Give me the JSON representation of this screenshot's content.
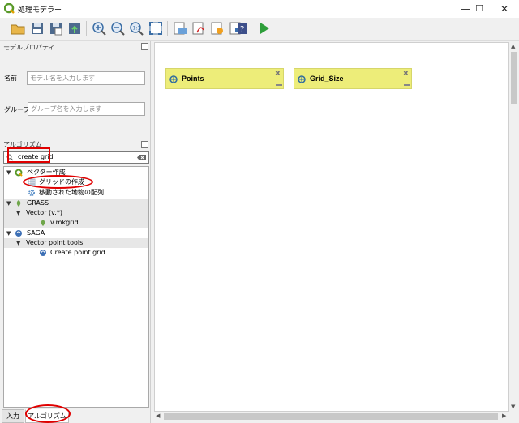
{
  "window": {
    "title": "処理モデラー",
    "controls": [
      "—",
      "☐",
      "✕"
    ]
  },
  "toolbar": {
    "icons": [
      "open-model-icon",
      "save-model-icon",
      "save-as-icon",
      "export-icon",
      "zoom-in-icon",
      "zoom-out-icon",
      "zoom-actual-icon",
      "zoom-full-icon",
      "export-image-icon",
      "export-pdf-icon",
      "export-svg-icon",
      "export-python-icon",
      "edit-help-icon",
      "run-model-icon"
    ]
  },
  "model_properties": {
    "title": "モデルプロパティ",
    "name_label": "名前",
    "name_placeholder": "モデル名を入力します",
    "group_label": "グループ",
    "group_placeholder": "グループ名を入力します"
  },
  "algorithms": {
    "title": "アルゴリズム",
    "search_value": "create grid",
    "tree": {
      "vector_creation": "ベクター作成",
      "create_grid": "グリッドの作成",
      "array_displaced": "移動された地物の配列",
      "grass": "GRASS",
      "vector_v": "Vector (v.*)",
      "v_mkgrid": "v.mkgrid",
      "saga": "SAGA",
      "vector_point_tools": "Vector point tools",
      "create_point_grid": "Create point grid"
    }
  },
  "tabs": {
    "input": "入力",
    "algorithms": "アルゴリズム"
  },
  "canvas": {
    "nodes": [
      "Points",
      "Grid_Size"
    ]
  },
  "colors": {
    "node_fill": "#eded79",
    "highlight": "#e00000",
    "run": "#2e9e3a"
  }
}
